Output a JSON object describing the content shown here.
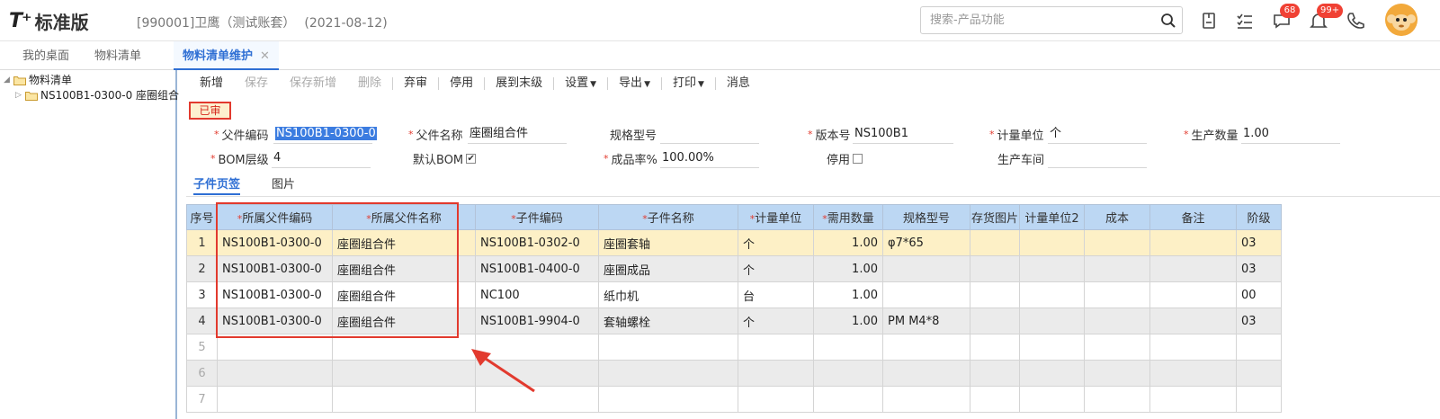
{
  "header": {
    "logo": "T⁺",
    "app_name": "标准版",
    "account": "[990001]卫鹰（测试账套）",
    "date": "(2021-08-12)",
    "search_placeholder": "搜索-产品功能",
    "msg_badge": "68",
    "notice_badge": "99+"
  },
  "tabs": [
    {
      "label": "我的桌面"
    },
    {
      "label": "物料清单"
    },
    {
      "label": "物料清单维护",
      "close": "✕"
    }
  ],
  "tree": {
    "root": "物料清单",
    "child": "NS100B1-0300-0 座圈组合"
  },
  "toolbar": {
    "add": "新增",
    "save": "保存",
    "save_add": "保存新增",
    "delete": "删除",
    "unaudit": "弃审",
    "disable": "停用",
    "expand": "展到末级",
    "settings": "设置",
    "export": "导出",
    "print": "打印",
    "message": "消息"
  },
  "status": "已审",
  "form": {
    "parent_code_label": "父件编码",
    "parent_code": "NS100B1-0300-0",
    "parent_name_label": "父件名称",
    "parent_name": "座圈组合件",
    "spec_label": "规格型号",
    "spec": "",
    "version_label": "版本号",
    "version": "NS100B1",
    "unit_label": "计量单位",
    "unit": "个",
    "qty_label": "生产数量",
    "qty": "1.00",
    "bom_level_label": "BOM层级",
    "bom_level": "4",
    "default_bom_label": "默认BOM",
    "default_bom_check": "✔",
    "yield_label": "成品率%",
    "yield": "100.00%",
    "disabled_label": "停用",
    "workshop_label": "生产车间",
    "workshop": ""
  },
  "subtabs": {
    "components": "子件页签",
    "images": "图片"
  },
  "grid": {
    "headers": [
      "序号",
      "所属父件编码",
      "所属父件名称",
      "子件编码",
      "子件名称",
      "计量单位",
      "需用数量",
      "规格型号",
      "存货图片",
      "计量单位2",
      "成本",
      "备注",
      "阶级"
    ],
    "rows": [
      [
        "1",
        "NS100B1-0300-0",
        "座圈组合件",
        "NS100B1-0302-0",
        "座圈套轴",
        "个",
        "1.00",
        "φ7*65",
        "",
        "",
        "",
        "",
        "03"
      ],
      [
        "2",
        "NS100B1-0300-0",
        "座圈组合件",
        "NS100B1-0400-0",
        "座圈成品",
        "个",
        "1.00",
        "",
        "",
        "",
        "",
        "",
        "03"
      ],
      [
        "3",
        "NS100B1-0300-0",
        "座圈组合件",
        "NC100",
        "纸巾机",
        "台",
        "1.00",
        "",
        "",
        "",
        "",
        "",
        "00"
      ],
      [
        "4",
        "NS100B1-0300-0",
        "座圈组合件",
        "NS100B1-9904-0",
        "套轴螺栓",
        "个",
        "1.00",
        "PM  M4*8",
        "",
        "",
        "",
        "",
        "03"
      ],
      [
        "5",
        "",
        "",
        "",
        "",
        "",
        "",
        "",
        "",
        "",
        "",
        "",
        ""
      ],
      [
        "6",
        "",
        "",
        "",
        "",
        "",
        "",
        "",
        "",
        "",
        "",
        "",
        ""
      ],
      [
        "7",
        "",
        "",
        "",
        "",
        "",
        "",
        "",
        "",
        "",
        "",
        "",
        ""
      ]
    ]
  }
}
